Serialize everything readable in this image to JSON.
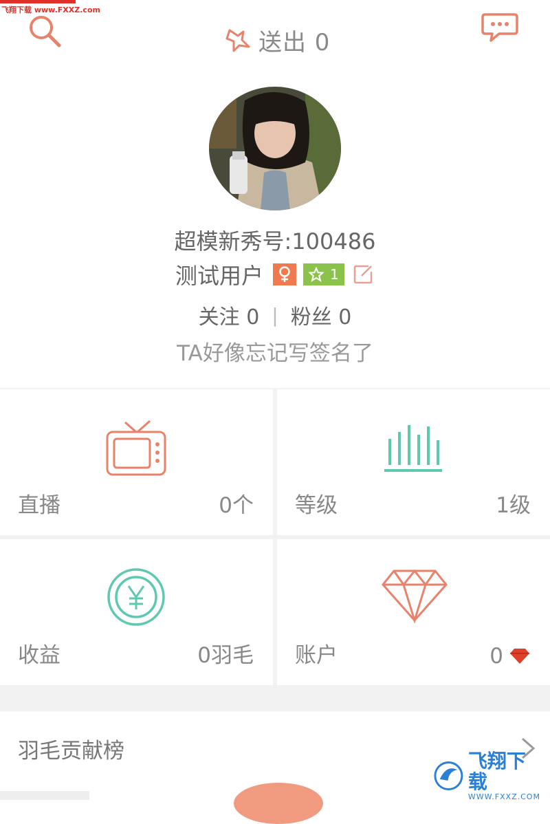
{
  "watermark": {
    "top": "飞翔下载 www.FXXZ.com",
    "corner_main": "飞翔下载",
    "corner_sub": "WWW.FXXZ.COM"
  },
  "header": {
    "sent_label": "送出 0"
  },
  "icons": {
    "search": "search-icon",
    "chat": "chat-bubble-icon",
    "sent": "star-send-icon"
  },
  "profile": {
    "id_text": "超模新秀号:100486",
    "name": "测试用户",
    "level_badge": "1",
    "follow": "关注 0",
    "separator": "|",
    "fans": "粉丝 0",
    "signature": "TA好像忘记写签名了"
  },
  "stats": {
    "live": {
      "label": "直播",
      "value": "0个"
    },
    "level": {
      "label": "等级",
      "value": "1级"
    },
    "income": {
      "label": "收益",
      "value": "0羽毛"
    },
    "account": {
      "label": "账户",
      "value": "0"
    }
  },
  "menu": {
    "feather_rank": "羽毛贡献榜"
  },
  "colors": {
    "accent_orange": "#e8826a",
    "accent_teal": "#5ec8b0",
    "gender_badge": "#f07a4f",
    "level_badge": "#8bc34a",
    "diamond_red": "#e0402a"
  }
}
